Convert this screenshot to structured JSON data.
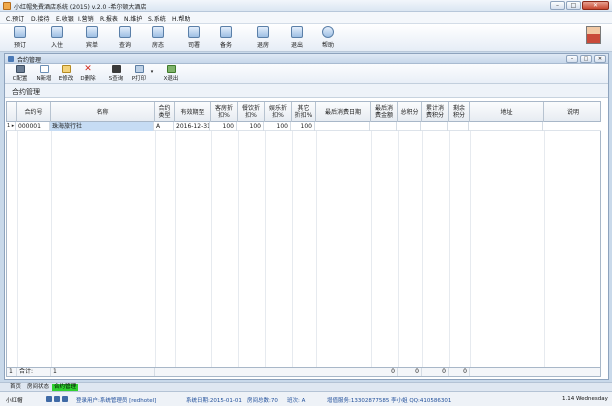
{
  "window": {
    "title": "小红帽免費酒店系统 (2015)  v.2.0  -希尔顿大酒店"
  },
  "menu": [
    {
      "label": "C.预订"
    },
    {
      "label": "D.接待"
    },
    {
      "label": "E.收银"
    },
    {
      "label": "I.营销"
    },
    {
      "label": "R.报表"
    },
    {
      "label": "N.维护"
    },
    {
      "label": "S.系统"
    },
    {
      "label": "H.帮助"
    }
  ],
  "toolbar": [
    {
      "label": "预订",
      "icon": "calendar-icon"
    },
    {
      "label": "入住",
      "icon": "checkin-icon"
    },
    {
      "label": "宾单",
      "icon": "bill-icon"
    },
    {
      "label": "查询",
      "icon": "search-icon"
    },
    {
      "label": "房态",
      "icon": "room-status-icon"
    },
    {
      "label": "司署",
      "icon": "office-icon"
    },
    {
      "label": "备务",
      "icon": "service-icon"
    },
    {
      "label": "退房",
      "icon": "checkout-icon"
    },
    {
      "label": "退出",
      "icon": "exit-icon"
    },
    {
      "label": "帮助",
      "icon": "help-icon"
    }
  ],
  "inner_window": {
    "title": "合约管理",
    "heading": "合约管理",
    "toolbar": [
      {
        "label": "C配置",
        "icon": "gear-icon"
      },
      {
        "label": "N新增",
        "icon": "new-icon"
      },
      {
        "label": "E修改",
        "icon": "edit-icon"
      },
      {
        "label": "D删除",
        "icon": "delete-icon"
      },
      {
        "label": "S查询",
        "icon": "binoculars-icon"
      },
      {
        "label": "P打印",
        "icon": "print-icon"
      },
      {
        "label": "X退出",
        "icon": "exit-icon"
      }
    ]
  },
  "table": {
    "columns": [
      "",
      "合约号",
      "名称",
      "合约\n类型",
      "有效期至",
      "客房折\n扣%",
      "餐饮折\n扣%",
      "娱乐折\n扣%",
      "其它\n折扣%",
      "最后消费日期",
      "最后消\n费金额",
      "总积分",
      "累计消\n费积分",
      "剩余\n积分",
      "地址",
      "说明"
    ],
    "rows": [
      {
        "marker": "1 ▸",
        "id": "000001",
        "name": "珠海旅行社",
        "type": "A",
        "expiry": "2016-12-31",
        "room_disc": "100",
        "dining_disc": "100",
        "ent_disc": "100",
        "other_disc": "100",
        "last_date": "",
        "last_amount": "",
        "total_points": "",
        "cum_points": "",
        "remain_points": "",
        "address": "",
        "notes": ""
      }
    ],
    "footer": {
      "marker": "1",
      "label": "合计:",
      "count": "1",
      "last_amount": "0",
      "total_points": "0",
      "cum_points": "0",
      "remain_points": "0"
    }
  },
  "tabs": [
    {
      "label": "首页",
      "active": false
    },
    {
      "label": "房间状态",
      "active": false
    },
    {
      "label": "合约管理",
      "active": true
    }
  ],
  "status": {
    "app": "小红帽",
    "user": "登录用户:系统管理员  [redhotel]",
    "date": "系统日期:2015-01-01",
    "rooms": "房间总数:70",
    "shift": "班次: A",
    "service": "增值服务:13302877585  李小姐  QQ:410586301",
    "version": "1.14  Wednesday"
  },
  "colors": {
    "active_tab": "#2fd12f",
    "selected_row": "#c6dcf4",
    "status_text": "#1f4e9a"
  }
}
